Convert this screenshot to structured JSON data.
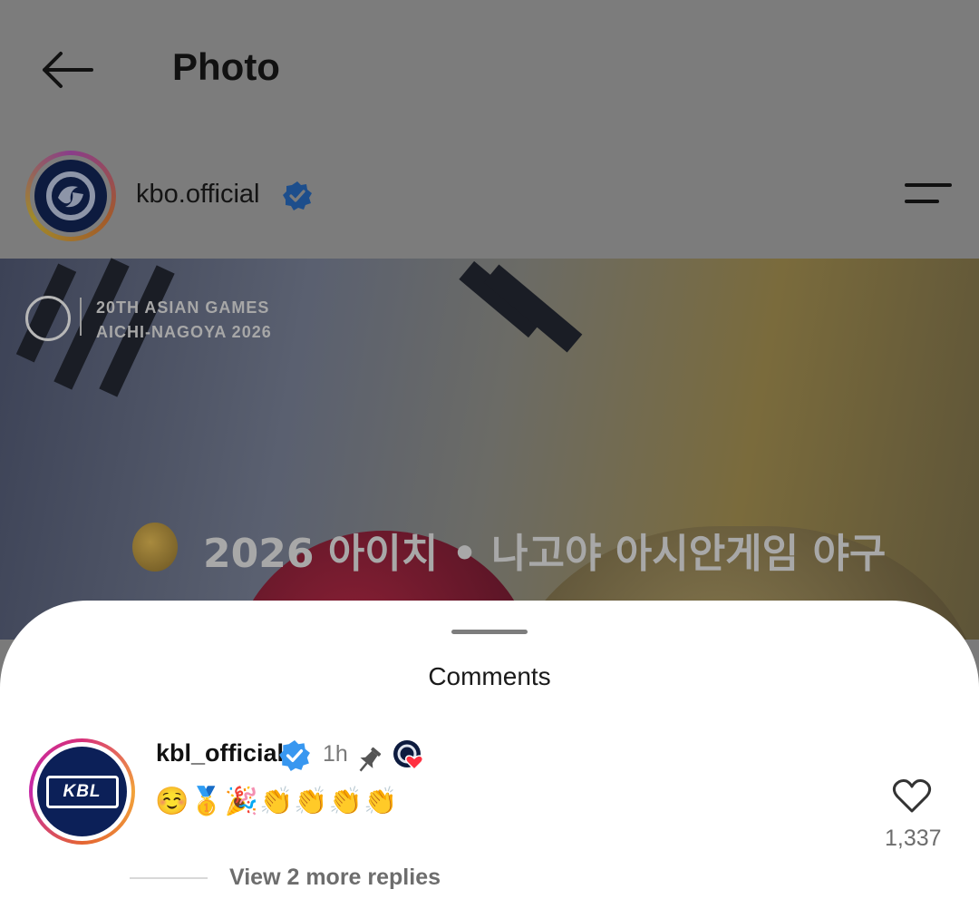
{
  "header": {
    "title": "Photo",
    "back_icon": "arrow-left-icon"
  },
  "post": {
    "username": "kbo.official",
    "verified": true,
    "menu_icon": "hamburger-menu-icon",
    "photo": {
      "event_line1": "20TH ASIAN GAMES",
      "event_line2": "AICHI-NAGOYA 2026",
      "caption": "2026 아이치 • 나고야 아시안게임 야구"
    }
  },
  "comments_sheet": {
    "title": "Comments",
    "comment": {
      "username": "kbl_official",
      "verified": true,
      "time": "1h",
      "pinned": true,
      "liked_by_author": true,
      "logo_text": "KBL",
      "text": "☺️🥇🎉👏👏👏👏",
      "like_count": "1,337",
      "view_replies": "View 2 more replies"
    }
  },
  "colors": {
    "verified_blue": "#3897f0",
    "like_red": "#ff3040",
    "sheet_bg": "#ffffff"
  }
}
